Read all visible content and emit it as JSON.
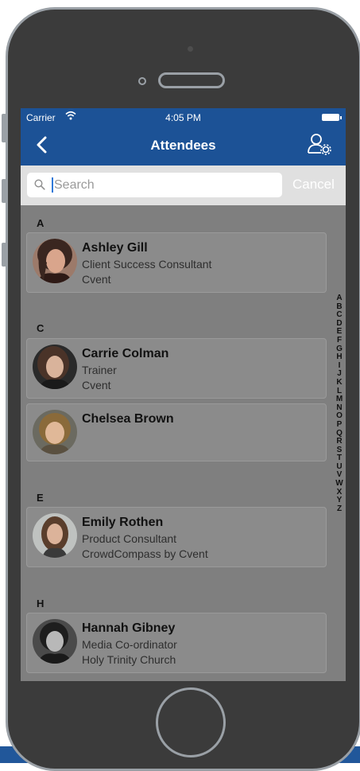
{
  "status_bar": {
    "carrier": "Carrier",
    "time": "4:05 PM"
  },
  "nav": {
    "title": "Attendees",
    "back_icon": "chevron-left-icon",
    "settings_icon": "user-gear-icon"
  },
  "search": {
    "placeholder": "Search",
    "cancel_label": "Cancel"
  },
  "sections": [
    {
      "letter": "A",
      "attendees": [
        {
          "name": "Ashley Gill",
          "title": "Client Success Consultant",
          "company": "Cvent"
        }
      ]
    },
    {
      "letter": "C",
      "attendees": [
        {
          "name": "Carrie Colman",
          "title": "Trainer",
          "company": "Cvent"
        },
        {
          "name": "Chelsea Brown",
          "title": "",
          "company": ""
        }
      ]
    },
    {
      "letter": "E",
      "attendees": [
        {
          "name": "Emily Rothen",
          "title": "Product Consultant",
          "company": "CrowdCompass by Cvent"
        }
      ]
    },
    {
      "letter": "H",
      "attendees": [
        {
          "name": "Hannah Gibney",
          "title": "Media Co-ordinator",
          "company": "Holy Trinity Church"
        }
      ]
    }
  ],
  "index_letters": [
    "A",
    "B",
    "C",
    "D",
    "E",
    "F",
    "G",
    "H",
    "I",
    "J",
    "K",
    "L",
    "M",
    "N",
    "O",
    "P",
    "Q",
    "R",
    "S",
    "T",
    "U",
    "V",
    "W",
    "X",
    "Y",
    "Z"
  ],
  "colors": {
    "nav_bar": "#1c5296",
    "overlay": "#7f7f7f",
    "cursor": "#2f79d8"
  }
}
